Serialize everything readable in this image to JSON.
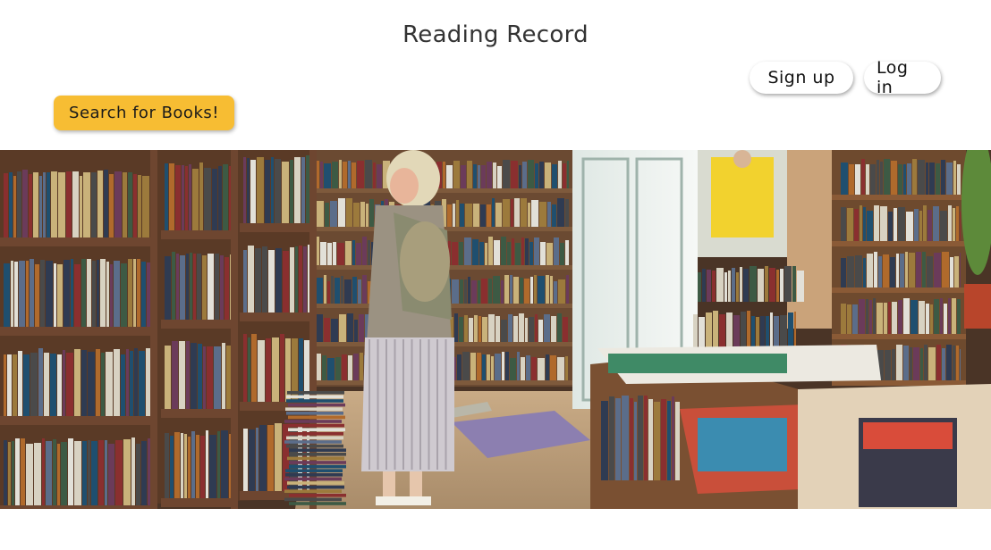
{
  "header": {
    "title": "Reading Record"
  },
  "auth": {
    "signup_label": "Sign up",
    "login_label": "Log in"
  },
  "search": {
    "button_label": "Search for Books!"
  },
  "hero": {
    "alt": "hero-bookstore-image"
  },
  "colors": {
    "search_button": "#f7bd33",
    "background": "#ffffff",
    "title_text": "#333333"
  }
}
